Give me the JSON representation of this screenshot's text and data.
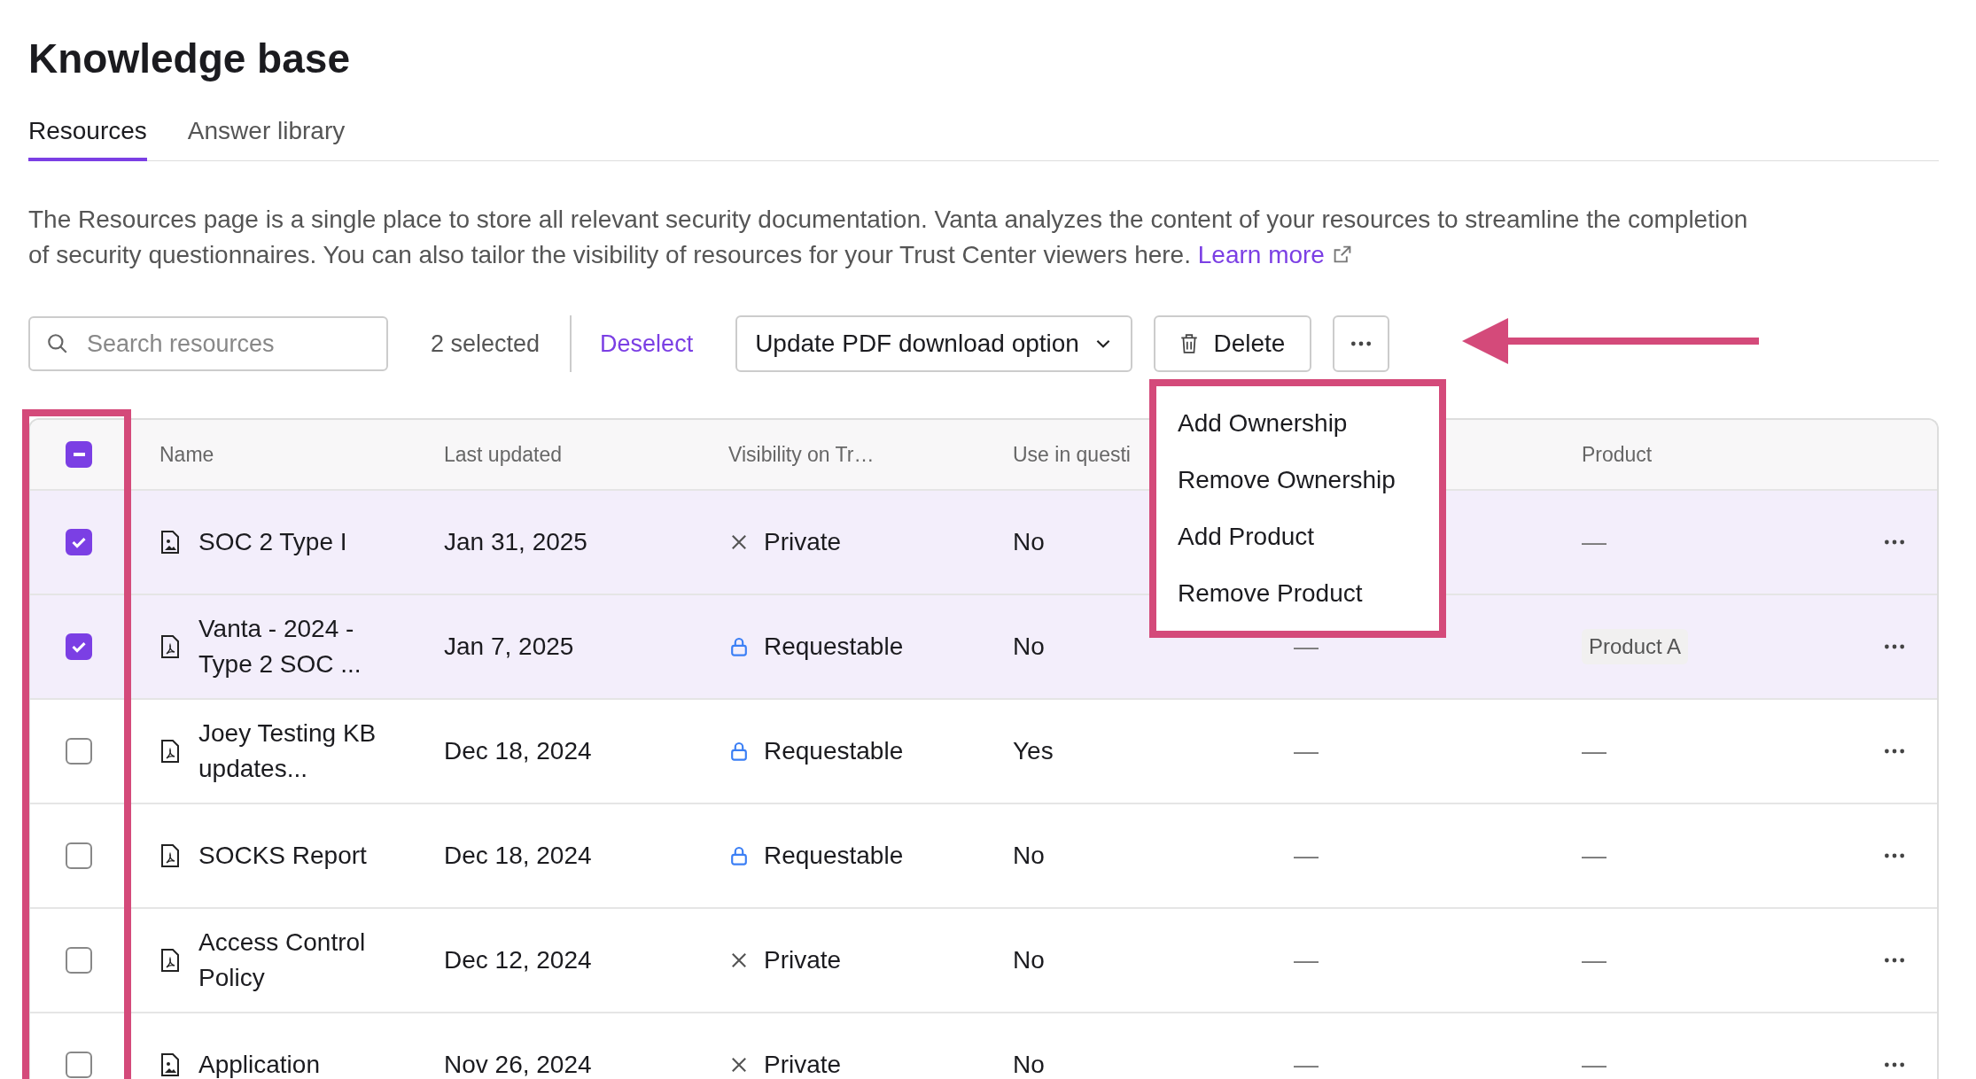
{
  "title": "Knowledge base",
  "tabs": [
    {
      "label": "Resources",
      "selected": true
    },
    {
      "label": "Answer library",
      "selected": false
    }
  ],
  "description": {
    "text": "The Resources page is a single place to store all relevant security documentation. Vanta analyzes the content of your resources to streamline the completion of security questionnaires. You can also tailor the visibility of resources for your Trust Center viewers here.",
    "link": "Learn more"
  },
  "toolbar": {
    "search": {
      "placeholder": "Search resources"
    },
    "selection_count": "2 selected",
    "deselect": "Deselect",
    "bulk_action": "Update PDF download option",
    "delete": "Delete"
  },
  "menu": {
    "items": [
      "Add Ownership",
      "Remove Ownership",
      "Add Product",
      "Remove Product"
    ]
  },
  "table": {
    "select_all": {
      "indeterminate": true
    },
    "columns": [
      "Name",
      "Last updated",
      "Visibility on Tr…",
      "Use in questi",
      "Product"
    ],
    "rows": [
      {
        "selected": true,
        "kind": "image",
        "name": "SOC 2 Type I",
        "last_updated": "Jan 31, 2025",
        "visibility": {
          "kind": "private",
          "label": "Private"
        },
        "use_in_questionnaires": "No",
        "product": {
          "kind": "plain",
          "label": "—"
        }
      },
      {
        "selected": true,
        "kind": "pdf",
        "name": "Vanta - 2024 - Type 2 SOC ...",
        "last_updated": "Jan 7, 2025",
        "visibility": {
          "kind": "requestable",
          "label": "Requestable"
        },
        "use_in_questionnaires": "No",
        "column_5": "—",
        "product": {
          "kind": "tag",
          "label": "Product A"
        }
      },
      {
        "selected": false,
        "kind": "pdf",
        "name": "Joey Testing KB updates...",
        "last_updated": "Dec 18, 2024",
        "visibility": {
          "kind": "requestable",
          "label": "Requestable"
        },
        "use_in_questionnaires": "Yes",
        "column_5": "—",
        "product": {
          "kind": "plain",
          "label": "—"
        }
      },
      {
        "selected": false,
        "kind": "pdf",
        "name": "SOCKS Report",
        "last_updated": "Dec 18, 2024",
        "visibility": {
          "kind": "requestable",
          "label": "Requestable"
        },
        "use_in_questionnaires": "No",
        "column_5": "—",
        "product": {
          "kind": "plain",
          "label": "—"
        }
      },
      {
        "selected": false,
        "kind": "pdf",
        "name": "Access Control Policy",
        "last_updated": "Dec 12, 2024",
        "visibility": {
          "kind": "private",
          "label": "Private"
        },
        "use_in_questionnaires": "No",
        "column_5": "—",
        "product": {
          "kind": "plain",
          "label": "—"
        }
      },
      {
        "selected": false,
        "kind": "image",
        "name": "Application",
        "last_updated": "Nov 26, 2024",
        "visibility": {
          "kind": "private",
          "label": "Private"
        },
        "use_in_questionnaires": "No",
        "column_5": "—",
        "product": {
          "kind": "plain",
          "label": "—"
        }
      }
    ]
  }
}
